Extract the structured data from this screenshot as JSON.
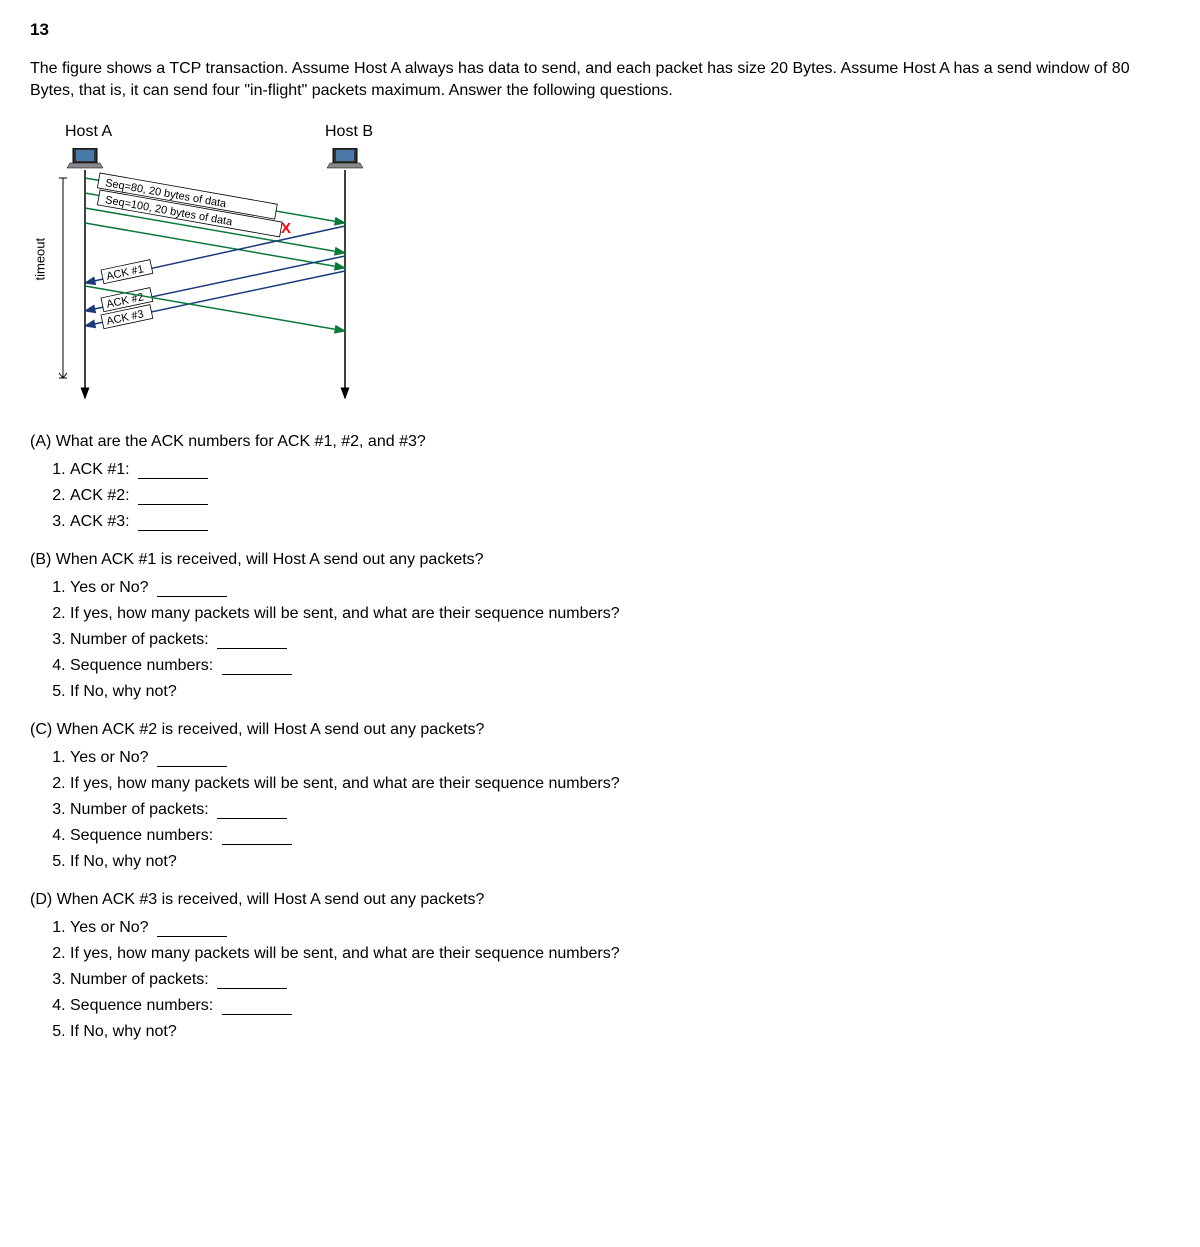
{
  "questionNumber": "13",
  "introText": "The figure shows a TCP transaction. Assume Host A always has data to send, and each packet has size 20 Bytes. Assume Host A has a send window of 80 Bytes, that is, it can send four \"in-flight\" packets maximum. Answer the following questions.",
  "diagram": {
    "hostA": "Host A",
    "hostB": "Host B",
    "timeout": "timeout",
    "seq1": "Seq=80, 20 bytes of data",
    "seq2": "Seq=100, 20 bytes of data",
    "lostMark": "X",
    "ack1": "ACK #1",
    "ack2": "ACK #2",
    "ack3": "ACK #3"
  },
  "partA": {
    "heading": "(A) What are the ACK numbers for ACK #1, #2, and #3?",
    "items": [
      "ACK #1:",
      "ACK #2:",
      "ACK #3:"
    ]
  },
  "partB": {
    "heading": "(B) When ACK #1 is received, will Host A send out any packets?",
    "items": [
      "Yes or No?",
      "If yes, how many packets will be sent, and what are their sequence numbers?",
      "Number of packets:",
      "Sequence numbers:",
      "If No, why not?"
    ]
  },
  "partC": {
    "heading": "(C) When ACK #2 is received, will Host A send out any packets?",
    "items": [
      "Yes or No?",
      "If yes, how many packets will be sent, and what are their sequence numbers?",
      "Number of packets:",
      "Sequence numbers:",
      "If No, why not?"
    ]
  },
  "partD": {
    "heading": "(D) When ACK #3 is received, will Host A send out any packets?",
    "items": [
      "Yes or No?",
      "If yes, how many packets will be sent, and what are their sequence numbers?",
      "Number of packets:",
      "Sequence numbers:",
      "If No, why not?"
    ]
  }
}
